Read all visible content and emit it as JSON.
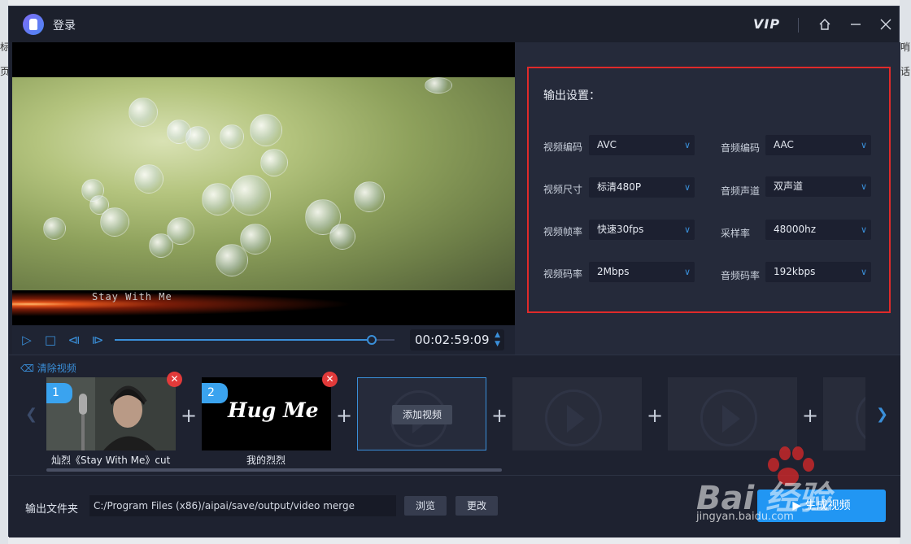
{
  "background": {
    "left_chars": [
      "标",
      "页"
    ],
    "right_chars": [
      "哨",
      "话"
    ]
  },
  "titlebar": {
    "title": "登录",
    "vip": "VIP",
    "home_icon": "home-icon",
    "minimize_icon": "minimize-icon",
    "close_icon": "close-icon"
  },
  "preview": {
    "subtitle": "Stay With Me"
  },
  "player": {
    "time": "00:02:59:09",
    "progress": 0.92,
    "play_icon": "▷",
    "stop_icon": "□",
    "prev_icon": "⧏",
    "next_icon": "⧐"
  },
  "settings": {
    "title": "输出设置：",
    "rows": [
      {
        "left_label": "视频编码",
        "left_value": "AVC",
        "right_label": "音频编码",
        "right_value": "AAC"
      },
      {
        "left_label": "视频尺寸",
        "left_value": "标清480P",
        "right_label": "音频声道",
        "right_value": "双声道"
      },
      {
        "left_label": "视频帧率",
        "left_value": "快速30fps",
        "right_label": "采样率",
        "right_value": "48000hz"
      },
      {
        "left_label": "视频码率",
        "left_value": "2Mbps",
        "right_label": "音频码率",
        "right_value": "192kbps"
      }
    ]
  },
  "clips": {
    "clear_label": "清除视频",
    "items": [
      {
        "num": "1",
        "name": "灿烈《Stay With Me》cut"
      },
      {
        "num": "2",
        "name": "我的烈烈",
        "thumb_text": "Hug Me"
      }
    ],
    "add_label": "添加视频",
    "plus": "+"
  },
  "output": {
    "label": "输出文件夹",
    "path": "C:/Program Files (x86)/aipai/save/output/video merge",
    "browse": "浏览",
    "change": "更改",
    "generate": "▶ 生成视频"
  },
  "watermark": {
    "text": "Bai 经验",
    "url": "jingyan.baidu.com"
  },
  "colors": {
    "accent": "#3a8fd9",
    "highlight_box": "#e02a2a",
    "primary_button": "#2196f3"
  }
}
